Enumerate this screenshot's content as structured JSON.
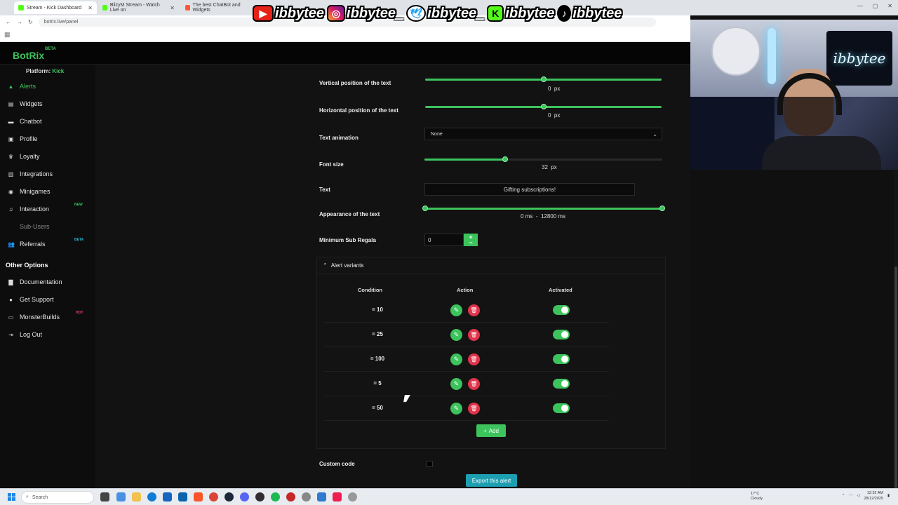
{
  "browser": {
    "tabs": [
      {
        "title": "Stream - Kick Dashboard",
        "active": true
      },
      {
        "title": "BilzyM Stream - Watch Live on",
        "active": false
      },
      {
        "title": "The best ChatBot and Widgets",
        "active": false
      }
    ],
    "url": "botrix.live/panel"
  },
  "overlay": {
    "socials": [
      {
        "icon": "youtube-icon",
        "glyph": "▶",
        "handle": "ibbytee"
      },
      {
        "icon": "instagram-icon",
        "glyph": "◎",
        "handle": "ibbytee_"
      },
      {
        "icon": "twitter-icon",
        "glyph": "🕊",
        "handle": "ibbytee_"
      },
      {
        "icon": "kick-icon",
        "glyph": "K",
        "handle": "ibbytee"
      },
      {
        "icon": "tiktok-icon",
        "glyph": "♪",
        "handle": "ibbytee"
      }
    ],
    "webcam_sign": "ibbytee"
  },
  "app": {
    "logo": "BotRix",
    "logo_badge": "BETA",
    "platform_label": "Platform:",
    "platform_value": "Kick"
  },
  "sidebar": {
    "items": [
      {
        "label": "Alerts",
        "icon": "bell-icon",
        "glyph": "▲",
        "active": true
      },
      {
        "label": "Widgets",
        "icon": "widgets-icon",
        "glyph": "▤"
      },
      {
        "label": "Chatbot",
        "icon": "chat-icon",
        "glyph": "▬"
      },
      {
        "label": "Profile",
        "icon": "profile-icon",
        "glyph": "▣"
      },
      {
        "label": "Loyalty",
        "icon": "trophy-icon",
        "glyph": "♛"
      },
      {
        "label": "Integrations",
        "icon": "integrations-icon",
        "glyph": "▥"
      },
      {
        "label": "Minigames",
        "icon": "gamepad-icon",
        "glyph": "◉"
      },
      {
        "label": "Interaction",
        "icon": "music-icon",
        "glyph": "♫",
        "badge": "NEW"
      },
      {
        "label": "Sub-Users",
        "icon": "sub-users-icon",
        "glyph": "",
        "dim": true
      },
      {
        "label": "Referrals",
        "icon": "users-icon",
        "glyph": "👥",
        "badge": "BETA"
      }
    ],
    "other_title": "Other Options",
    "other_items": [
      {
        "label": "Documentation",
        "icon": "book-icon",
        "glyph": "▇"
      },
      {
        "label": "Get Support",
        "icon": "question-icon",
        "glyph": "●"
      },
      {
        "label": "MonsterBuilds",
        "icon": "laptop-icon",
        "glyph": "▭",
        "badge": "HOT"
      },
      {
        "label": "Log Out",
        "icon": "logout-icon",
        "glyph": "⇥"
      }
    ]
  },
  "form": {
    "vertical_label": "Vertical position of the text",
    "vertical_value": "0",
    "vertical_unit": "px",
    "vertical_fraction": 0.5,
    "horizontal_label": "Horizontal position of the text",
    "horizontal_value": "0",
    "horizontal_unit": "px",
    "horizontal_fraction": 0.5,
    "animation_label": "Text animation",
    "animation_value": "None",
    "font_label": "Font size",
    "font_value": "32",
    "font_unit": "px",
    "font_fraction": 0.34,
    "text_label": "Text",
    "text_value": "Gifting subscriptions!",
    "appearance_label": "Appearance of the text",
    "appearance_min": "0",
    "appearance_max": "12800",
    "appearance_unit": "ms",
    "appearance_sep": "-",
    "min_sub_label": "Minimum Sub Regala",
    "min_sub_value": "0",
    "custom_code_label": "Custom code",
    "export_label": "Export this alert"
  },
  "variants": {
    "title": "Alert variants",
    "headers": {
      "condition": "Condition",
      "action": "Action",
      "activated": "Activated"
    },
    "rows": [
      {
        "condition": "= 10",
        "activated": true
      },
      {
        "condition": "= 25",
        "activated": true
      },
      {
        "condition": "= 100",
        "activated": true
      },
      {
        "condition": "= 5",
        "activated": true
      },
      {
        "condition": "= 50",
        "activated": true
      }
    ],
    "add_label": "Add"
  },
  "taskbar": {
    "search_placeholder": "Search",
    "weather_temp": "17°C",
    "weather_desc": "Cloudy",
    "time": "12:32 AM",
    "date": "28/12/2025"
  },
  "colors": {
    "accent": "#3cc35c",
    "danger": "#e0344a",
    "info": "#1d9fb2"
  }
}
